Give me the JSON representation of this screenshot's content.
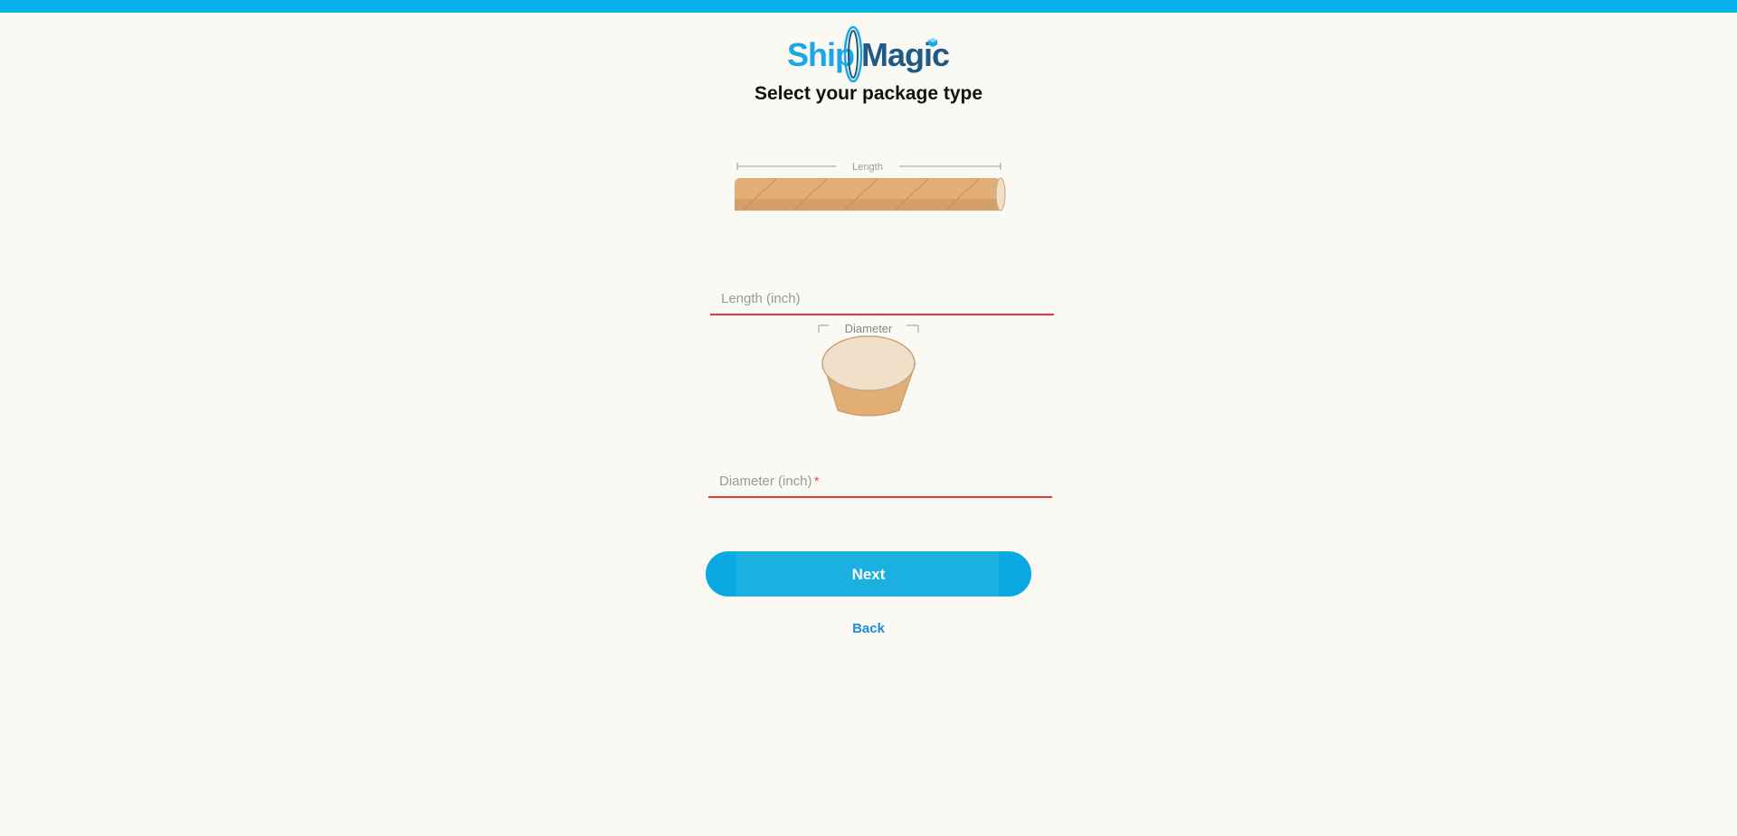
{
  "brand": {
    "name_part1": "Ship",
    "name_part2": "Magic",
    "color_primary": "#1aa7e8",
    "color_dark": "#1d5b86",
    "logo_icon": "ring-logo-icon"
  },
  "page": {
    "title": "Select your package type",
    "top_bar_color": "#06b1ec"
  },
  "tube": {
    "label": "Length"
  },
  "cone": {
    "label": "Diameter"
  },
  "fields": {
    "length": {
      "value": "",
      "placeholder": "Length (inch)",
      "required": false
    },
    "diameter": {
      "value": "",
      "placeholder": "Diameter (inch)",
      "required_marker": "*"
    },
    "error_color": "#e53935"
  },
  "actions": {
    "next_label": "Next",
    "back_label": "Back"
  }
}
